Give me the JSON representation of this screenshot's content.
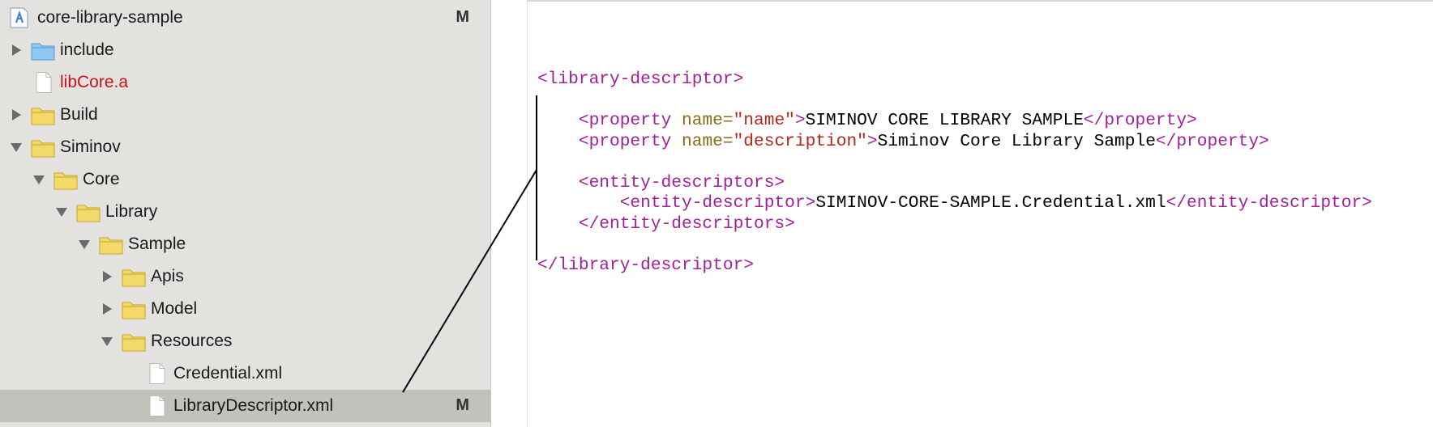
{
  "navigator": {
    "items": [
      {
        "label": "core-library-sample",
        "icon": "project-icon",
        "depth": 0,
        "disclosure": "none",
        "badge": "M"
      },
      {
        "label": "include",
        "icon": "blue-folder-icon",
        "depth": 0,
        "disclosure": "collapsed"
      },
      {
        "label": "libCore.a",
        "icon": "file-icon",
        "depth": 0,
        "disclosure": "none",
        "missing": true
      },
      {
        "label": "Build",
        "icon": "folder-icon",
        "depth": 0,
        "disclosure": "collapsed"
      },
      {
        "label": "Siminov",
        "icon": "folder-icon",
        "depth": 0,
        "disclosure": "expanded"
      },
      {
        "label": "Core",
        "icon": "folder-icon",
        "depth": 1,
        "disclosure": "expanded"
      },
      {
        "label": "Library",
        "icon": "folder-icon",
        "depth": 2,
        "disclosure": "expanded"
      },
      {
        "label": "Sample",
        "icon": "folder-icon",
        "depth": 3,
        "disclosure": "expanded"
      },
      {
        "label": "Apis",
        "icon": "folder-icon",
        "depth": 4,
        "disclosure": "collapsed"
      },
      {
        "label": "Model",
        "icon": "folder-icon",
        "depth": 4,
        "disclosure": "collapsed"
      },
      {
        "label": "Resources",
        "icon": "folder-icon",
        "depth": 4,
        "disclosure": "expanded"
      },
      {
        "label": "Credential.xml",
        "icon": "file-icon",
        "depth": 5,
        "disclosure": "none"
      },
      {
        "label": "LibraryDescriptor.xml",
        "icon": "file-icon",
        "depth": 5,
        "disclosure": "none",
        "badge": "M",
        "selected": true
      }
    ]
  },
  "editor": {
    "lines": [
      {
        "tokens": [
          {
            "t": "<library-descriptor>",
            "c": "tag"
          }
        ]
      },
      {
        "tokens": []
      },
      {
        "tokens": [
          {
            "t": "    <property ",
            "c": "tag"
          },
          {
            "t": "name=",
            "c": "attr"
          },
          {
            "t": "\"name\"",
            "c": "str"
          },
          {
            "t": ">",
            "c": "tag"
          },
          {
            "t": "SIMINOV CORE LIBRARY SAMPLE",
            "c": "txt"
          },
          {
            "t": "</property>",
            "c": "tag"
          }
        ]
      },
      {
        "tokens": [
          {
            "t": "    <property ",
            "c": "tag"
          },
          {
            "t": "name=",
            "c": "attr"
          },
          {
            "t": "\"description\"",
            "c": "str"
          },
          {
            "t": ">",
            "c": "tag"
          },
          {
            "t": "Siminov Core Library Sample",
            "c": "txt"
          },
          {
            "t": "</property>",
            "c": "tag"
          }
        ]
      },
      {
        "tokens": []
      },
      {
        "tokens": [
          {
            "t": "    <entity-descriptors>",
            "c": "tag"
          }
        ]
      },
      {
        "tokens": [
          {
            "t": "        <entity-descriptor",
            "c": "tag"
          },
          {
            "t": ">",
            "c": "tag"
          },
          {
            "t": "SIMINOV-CORE-SAMPLE.Credential.xml",
            "c": "txt"
          },
          {
            "t": "</entity-descriptor>",
            "c": "tag"
          }
        ]
      },
      {
        "tokens": [
          {
            "t": "    </entity-descriptors>",
            "c": "tag"
          }
        ]
      },
      {
        "tokens": []
      },
      {
        "tokens": [
          {
            "t": "</library-descriptor>",
            "c": "tag"
          }
        ]
      }
    ]
  },
  "colors": {
    "sidebar_bg": "#e3e2de",
    "selection_bg": "#c2c1bc",
    "missing_file_text": "#c4121b",
    "xml_tag": "#a21f9a",
    "xml_attribute": "#8b6a18",
    "xml_string": "#b3261e"
  }
}
